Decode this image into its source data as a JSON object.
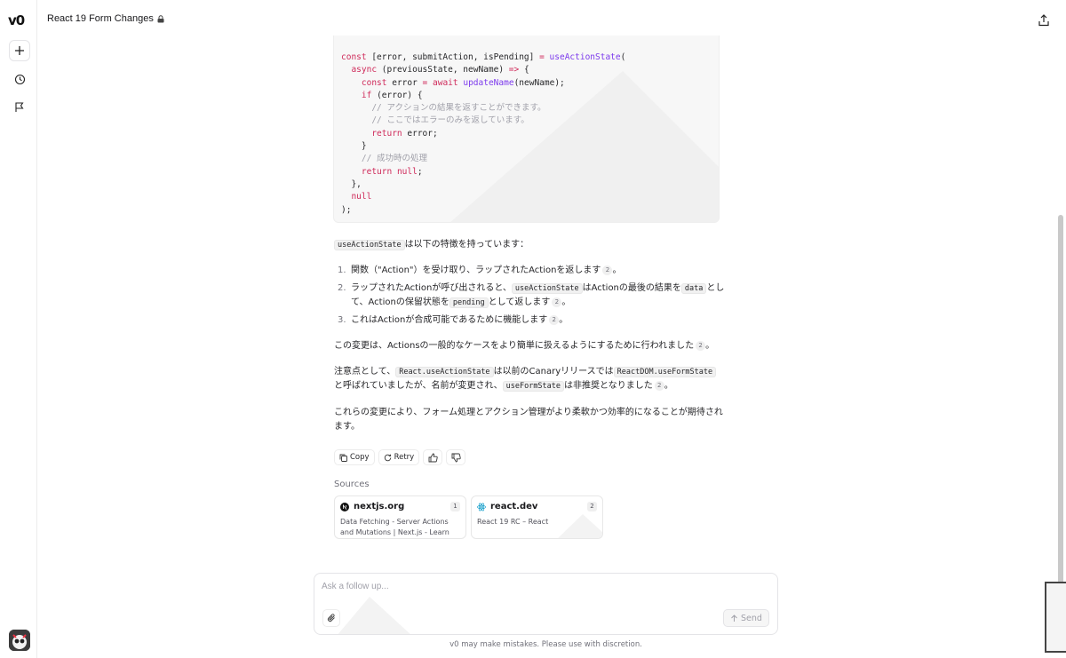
{
  "app": {
    "logo": "v0"
  },
  "header": {
    "title": "React 19 Form Changes"
  },
  "code": {
    "lines": [
      [
        [
          "kw",
          "const"
        ],
        [
          "p",
          " [error, submitAction, isPending] "
        ],
        [
          "op",
          "="
        ],
        [
          "p",
          " "
        ],
        [
          "fn",
          "useActionState"
        ],
        [
          "p",
          "("
        ]
      ],
      [
        [
          "p",
          "  "
        ],
        [
          "kw",
          "async"
        ],
        [
          "p",
          " (previousState, newName) "
        ],
        [
          "op",
          "=>"
        ],
        [
          "p",
          " {"
        ]
      ],
      [
        [
          "p",
          "    "
        ],
        [
          "kw",
          "const"
        ],
        [
          "p",
          " error "
        ],
        [
          "op",
          "="
        ],
        [
          "p",
          " "
        ],
        [
          "kw",
          "await"
        ],
        [
          "p",
          " "
        ],
        [
          "fn",
          "updateName"
        ],
        [
          "p",
          "(newName);"
        ]
      ],
      [
        [
          "p",
          "    "
        ],
        [
          "kw",
          "if"
        ],
        [
          "p",
          " (error) {"
        ]
      ],
      [
        [
          "p",
          "      "
        ],
        [
          "cm",
          "// アクションの結果を返すことができます。"
        ]
      ],
      [
        [
          "p",
          "      "
        ],
        [
          "cm",
          "// ここではエラーのみを返しています。"
        ]
      ],
      [
        [
          "p",
          "      "
        ],
        [
          "kw",
          "return"
        ],
        [
          "p",
          " error;"
        ]
      ],
      [
        [
          "p",
          "    }"
        ]
      ],
      [
        [
          "p",
          "    "
        ],
        [
          "cm",
          "// 成功時の処理"
        ]
      ],
      [
        [
          "p",
          "    "
        ],
        [
          "kw",
          "return"
        ],
        [
          "p",
          " "
        ],
        [
          "kw",
          "null"
        ],
        [
          "p",
          ";"
        ]
      ],
      [
        [
          "p",
          "  },"
        ]
      ],
      [
        [
          "p",
          "  "
        ],
        [
          "kw",
          "null"
        ]
      ],
      [
        [
          "p",
          ");"
        ]
      ]
    ]
  },
  "intro": {
    "code": "useActionState",
    "text": "は以下の特徴を持っています："
  },
  "features": [
    {
      "num": "1.",
      "parts": [
        [
          "t",
          "関数（\"Action\"）を受け取り、ラップされたActionを返します"
        ],
        [
          "r",
          "2"
        ],
        [
          "t",
          "。"
        ]
      ]
    },
    {
      "num": "2.",
      "parts": [
        [
          "t",
          "ラップされたActionが呼び出されると、"
        ],
        [
          "c",
          "useActionState"
        ],
        [
          "t",
          "はActionの最後の結果を"
        ],
        [
          "c",
          "data"
        ],
        [
          "t",
          "として、Actionの保留状態を"
        ],
        [
          "c",
          "pending"
        ],
        [
          "t",
          "として返します"
        ],
        [
          "r",
          "2"
        ],
        [
          "t",
          "。"
        ]
      ]
    },
    {
      "num": "3.",
      "parts": [
        [
          "t",
          "これはActionが合成可能であるために機能します"
        ],
        [
          "r",
          "2"
        ],
        [
          "t",
          "。"
        ]
      ]
    }
  ],
  "paragraphs": [
    [
      [
        "t",
        "この変更は、Actionsの一般的なケースをより簡単に扱えるようにするために行われました"
      ],
      [
        "r",
        "2"
      ],
      [
        "t",
        "。"
      ]
    ],
    [
      [
        "t",
        "注意点として、"
      ],
      [
        "c",
        "React.useActionState"
      ],
      [
        "t",
        "は以前のCanaryリリースでは"
      ],
      [
        "c",
        "ReactDOM.useFormState"
      ],
      [
        "t",
        "と呼ばれていましたが、名前が変更され、"
      ],
      [
        "c",
        "useFormState"
      ],
      [
        "t",
        "は非推奨となりました"
      ],
      [
        "r",
        "2"
      ],
      [
        "t",
        "。"
      ]
    ],
    [
      [
        "t",
        "これらの変更により、フォーム処理とアクション管理がより柔軟かつ効率的になることが期待されます。"
      ]
    ]
  ],
  "actions": {
    "copy": "Copy",
    "retry": "Retry"
  },
  "sources": {
    "label": "Sources",
    "items": [
      {
        "domain": "nextjs.org",
        "num": "1",
        "desc": "Data Fetching - Server Actions and Mutations | Next.js - Learn how..."
      },
      {
        "domain": "react.dev",
        "num": "2",
        "desc": "React 19 RC – React"
      }
    ]
  },
  "composer": {
    "placeholder": "Ask a follow up...",
    "send": "Send"
  },
  "disclaimer": "v0 may make mistakes. Please use with discretion."
}
